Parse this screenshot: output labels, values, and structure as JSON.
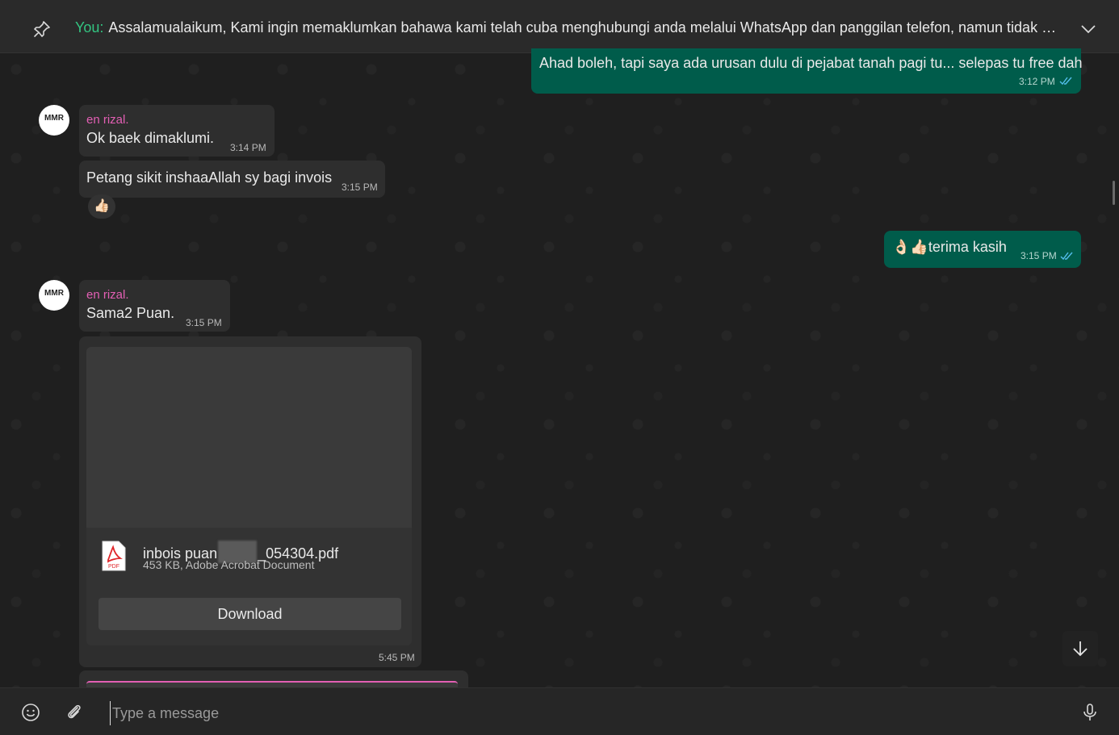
{
  "pinned": {
    "sender": "You:",
    "text": "Assalamualaikum,  Kami ingin memaklumkan bahawa kami telah cuba menghubungi anda melalui WhatsApp dan panggilan telefon, namun tidak mener..."
  },
  "messages": {
    "m1": {
      "text": "Ahad boleh, tapi saya ada urusan dulu di pejabat tanah pagi tu... selepas tu free dah",
      "time": "3:12 PM"
    },
    "m2": {
      "sender": "en rizal.",
      "text": "Ok baek dimaklumi.",
      "time": "3:14 PM"
    },
    "m3": {
      "text": "Petang sikit inshaaAllah sy bagi invois",
      "time": "3:15 PM",
      "reaction": "👍🏻"
    },
    "m4": {
      "text": "👌🏻👍🏻terima kasih",
      "time": "3:15 PM"
    },
    "m5": {
      "sender": "en rizal.",
      "text": "Sama2 Puan.",
      "time": "3:15 PM"
    },
    "m6": {
      "file_name_start": "inbois puan",
      "file_name_end": "_054304.pdf",
      "file_meta": "453 KB, Adobe Acrobat Document",
      "file_badge": "PDF",
      "download_label": "Download",
      "time": "5:45 PM"
    }
  },
  "avatar": {
    "text": "MMR"
  },
  "composer": {
    "placeholder": "Type a message"
  },
  "colors": {
    "accent": "#33c481",
    "outgoing": "#005c4b",
    "sender_name": "#e35fb4",
    "read_ticks": "#53bdeb"
  }
}
